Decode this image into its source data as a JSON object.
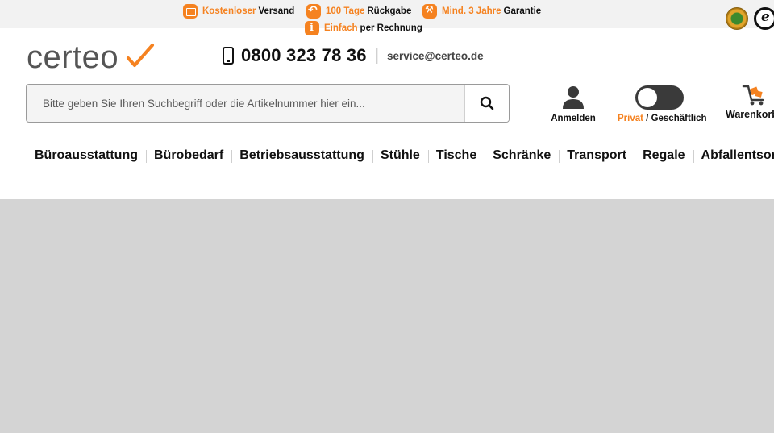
{
  "usp_bar": {
    "items": [
      {
        "highlight": "Kostenloser",
        "text": "Versand",
        "icon": "box-icon"
      },
      {
        "highlight": "100 Tage",
        "text": "Rückgabe",
        "icon": "return-icon"
      },
      {
        "highlight": "Mind. 3 Jahre",
        "text": "Garantie",
        "icon": "tools-icon"
      },
      {
        "highlight": "Einfach",
        "text": "per Rechnung",
        "icon": "info-icon"
      }
    ],
    "accent_color": "#f58220"
  },
  "header": {
    "logo_text": "certeo",
    "phone": "0800 323 78 36",
    "separator": "|",
    "email": "service@certeo.de"
  },
  "search": {
    "placeholder": "Bitte geben Sie Ihren Suchbegriff oder die Artikelnummer hier ein...",
    "value": "",
    "button_icon": "search-icon"
  },
  "account": {
    "label": "Anmelden",
    "icon": "user-icon"
  },
  "customer_type": {
    "private": "Privat",
    "separator": " / ",
    "business": "Geschäftlich",
    "selected": "Privat"
  },
  "cart": {
    "label": "Warenkorb",
    "icon": "cart-icon"
  },
  "nav": {
    "items": [
      "Büroausstattung",
      "Bürobedarf",
      "Betriebsausstattung",
      "Stühle",
      "Tische",
      "Schränke",
      "Transport",
      "Regale",
      "Abfallentsorgung"
    ]
  }
}
